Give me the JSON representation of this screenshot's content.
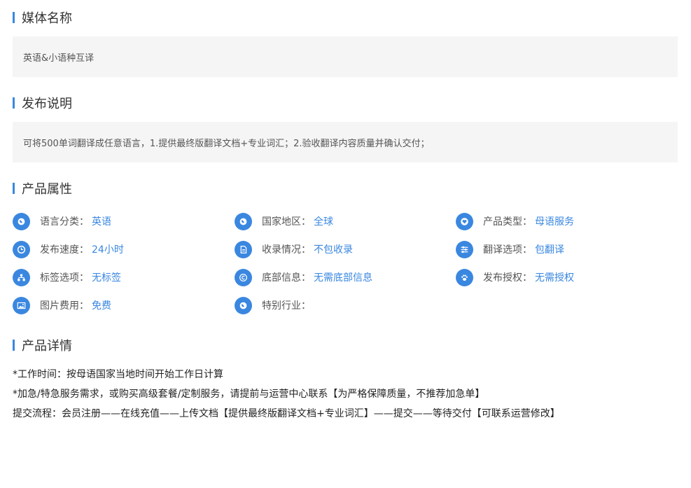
{
  "sections": {
    "media_name": {
      "title": "媒体名称",
      "content": "英语&小语种互译"
    },
    "publish_desc": {
      "title": "发布说明",
      "content": "可将500单词翻译成任意语言，1.提供最终版翻译文档+专业词汇；2.验收翻译内容质量并确认交付；"
    },
    "attributes": {
      "title": "产品属性"
    },
    "details": {
      "title": "产品详情"
    }
  },
  "attributes": [
    {
      "label": "语言分类：",
      "value": "英语",
      "icon": "globe-icon"
    },
    {
      "label": "国家地区：",
      "value": "全球",
      "icon": "globe-icon"
    },
    {
      "label": "产品类型：",
      "value": "母语服务",
      "icon": "heart-icon"
    },
    {
      "label": "发布速度：",
      "value": "24小时",
      "icon": "clock-icon"
    },
    {
      "label": "收录情况：",
      "value": "不包收录",
      "icon": "document-icon"
    },
    {
      "label": "翻译选项：",
      "value": "包翻译",
      "icon": "sliders-icon"
    },
    {
      "label": "标签选项：",
      "value": "无标签",
      "icon": "sitemap-icon"
    },
    {
      "label": "底部信息：",
      "value": "无需底部信息",
      "icon": "copyright-icon"
    },
    {
      "label": "发布授权：",
      "value": "无需授权",
      "icon": "paw-icon"
    },
    {
      "label": "图片费用：",
      "value": "免费",
      "icon": "image-icon"
    },
    {
      "label": "特别行业：",
      "value": "",
      "icon": "globe-icon"
    }
  ],
  "details": [
    "*工作时间：按母语国家当地时间开始工作日计算",
    "*加急/特急服务需求，或购买高级套餐/定制服务，请提前与运营中心联系【为严格保障质量，不推荐加急单】",
    "提交流程：会员注册——在线充值——上传文档【提供最终版翻译文档+专业词汇】——提交——等待交付【可联系运营修改】"
  ],
  "colors": {
    "accent": "#3a87e0",
    "box_bg": "#f5f5f5"
  }
}
